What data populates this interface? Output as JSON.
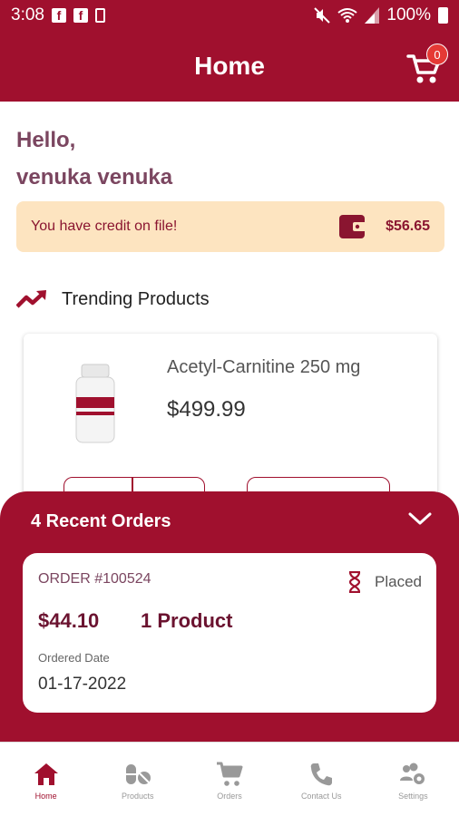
{
  "status_bar": {
    "time": "3:08",
    "battery_text": "100%",
    "icons": [
      "facebook-icon",
      "facebook-icon",
      "sim-icon",
      "mute-icon",
      "wifi-icon",
      "signal-icon",
      "battery-icon"
    ]
  },
  "header": {
    "title": "Home",
    "cart_count": "0"
  },
  "greeting": {
    "hello": "Hello,",
    "name": "venuka venuka"
  },
  "credit": {
    "message": "You have credit on file!",
    "amount": "$56.65",
    "icon": "wallet-icon"
  },
  "trending": {
    "title": "Trending Products",
    "icon": "trending-up-icon",
    "products": [
      {
        "name": "Acetyl-Carnitine 250 mg",
        "price": "$499.99"
      }
    ]
  },
  "recent_orders": {
    "title": "4 Recent Orders",
    "orders": [
      {
        "number": "ORDER #100524",
        "status": "Placed",
        "total": "$44.10",
        "product_count": "1 Product",
        "date_label": "Ordered Date",
        "date": "01-17-2022"
      }
    ]
  },
  "bottom_nav": {
    "items": [
      {
        "label": "Home",
        "icon": "home-icon",
        "active": true
      },
      {
        "label": "Products",
        "icon": "pills-icon",
        "active": false
      },
      {
        "label": "Orders",
        "icon": "cart-icon",
        "active": false
      },
      {
        "label": "Contact Us",
        "icon": "phone-icon",
        "active": false
      },
      {
        "label": "Settings",
        "icon": "users-gear-icon",
        "active": false
      }
    ]
  },
  "colors": {
    "primary": "#a0102e",
    "credit_bg": "#fde4c0",
    "greeting_text": "#7b4660",
    "nav_inactive": "#999999"
  }
}
